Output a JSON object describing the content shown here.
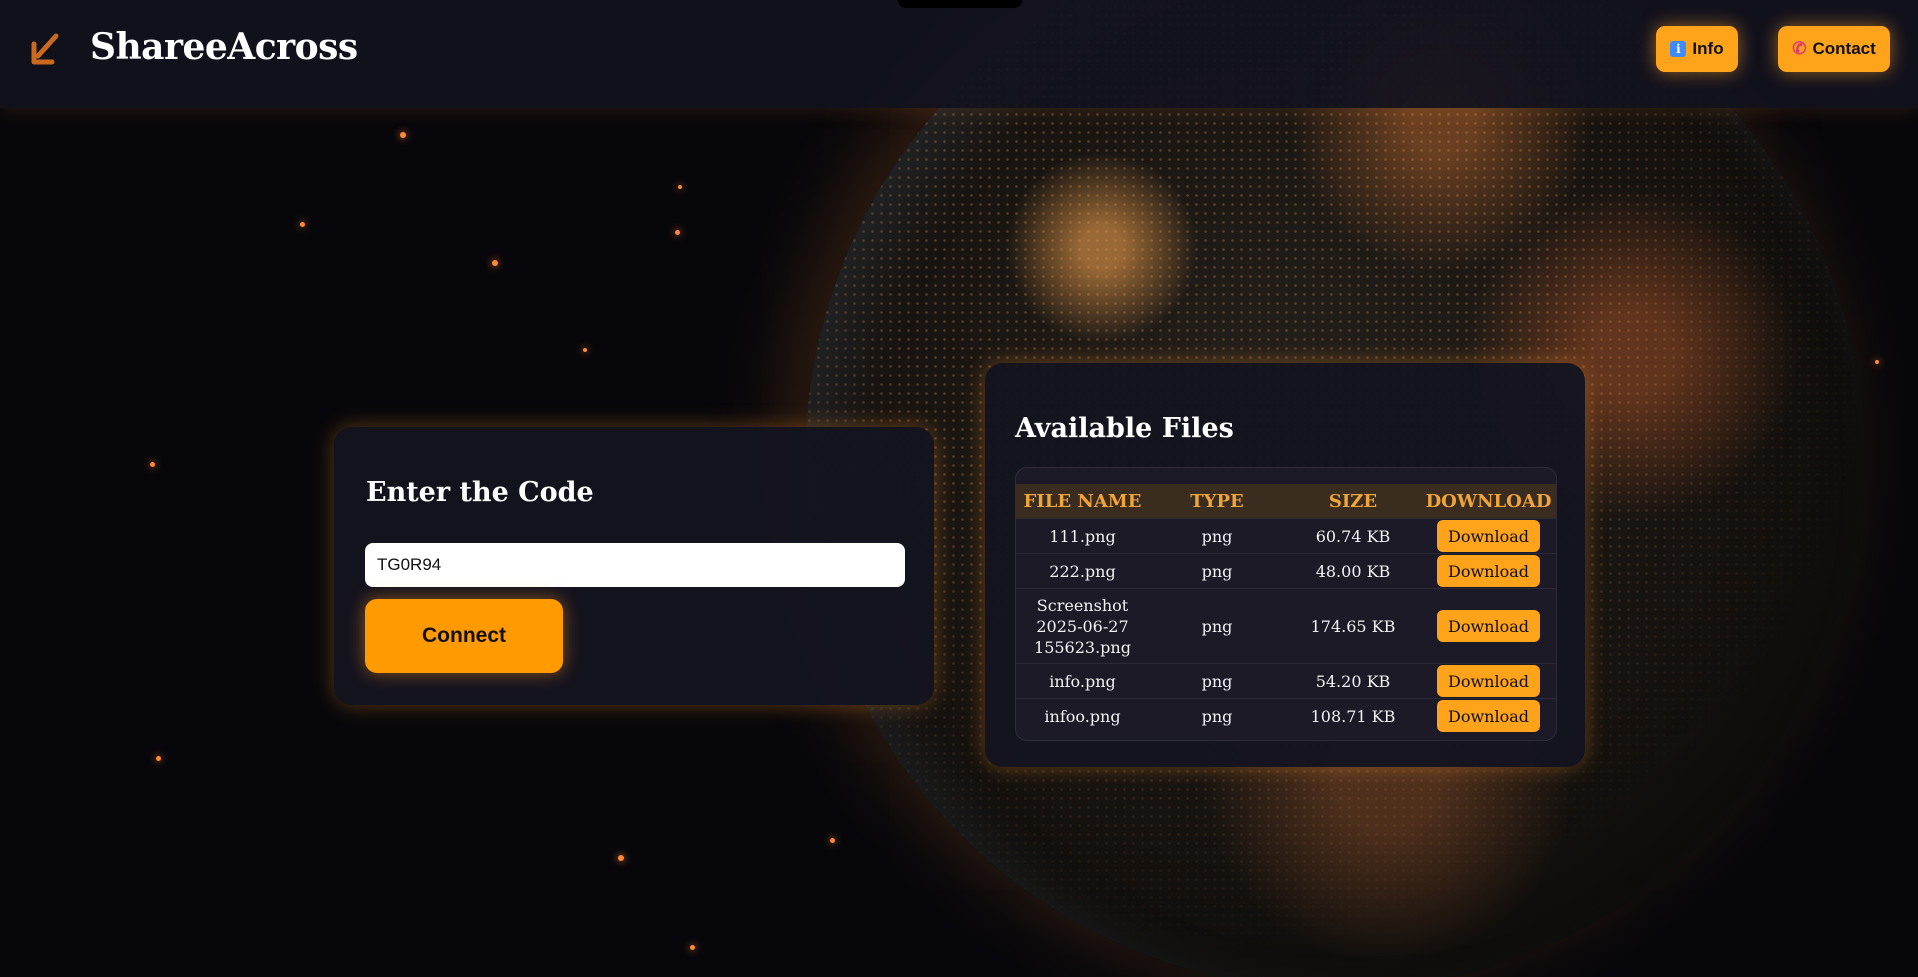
{
  "header": {
    "brand": "ShareeAcross",
    "info_label": "Info",
    "contact_label": "Contact"
  },
  "code_card": {
    "title": "Enter the Code",
    "code_value": "TG0R94",
    "connect_label": "Connect"
  },
  "files_card": {
    "title": "Available Files",
    "columns": [
      "FILE NAME",
      "TYPE",
      "SIZE",
      "DOWNLOAD"
    ],
    "rows": [
      {
        "name": "111.png",
        "type": "png",
        "size": "60.74 KB",
        "action": "Download"
      },
      {
        "name": "222.png",
        "type": "png",
        "size": "48.00 KB",
        "action": "Download"
      },
      {
        "name": "Screenshot 2025-06-27 155623.png",
        "type": "png",
        "size": "174.65 KB",
        "action": "Download"
      },
      {
        "name": "info.png",
        "type": "png",
        "size": "54.20 KB",
        "action": "Download"
      },
      {
        "name": "infoo.png",
        "type": "png",
        "size": "108.71 KB",
        "action": "Download"
      }
    ]
  },
  "colors": {
    "accent": "#ffa31a",
    "header_bg": "#12121e",
    "card_bg": "#141420",
    "table_header_text": "#f0a43a"
  },
  "icons": {
    "logo": "arrow-diagonal-icon",
    "info": "info-icon",
    "contact": "phone-icon"
  }
}
